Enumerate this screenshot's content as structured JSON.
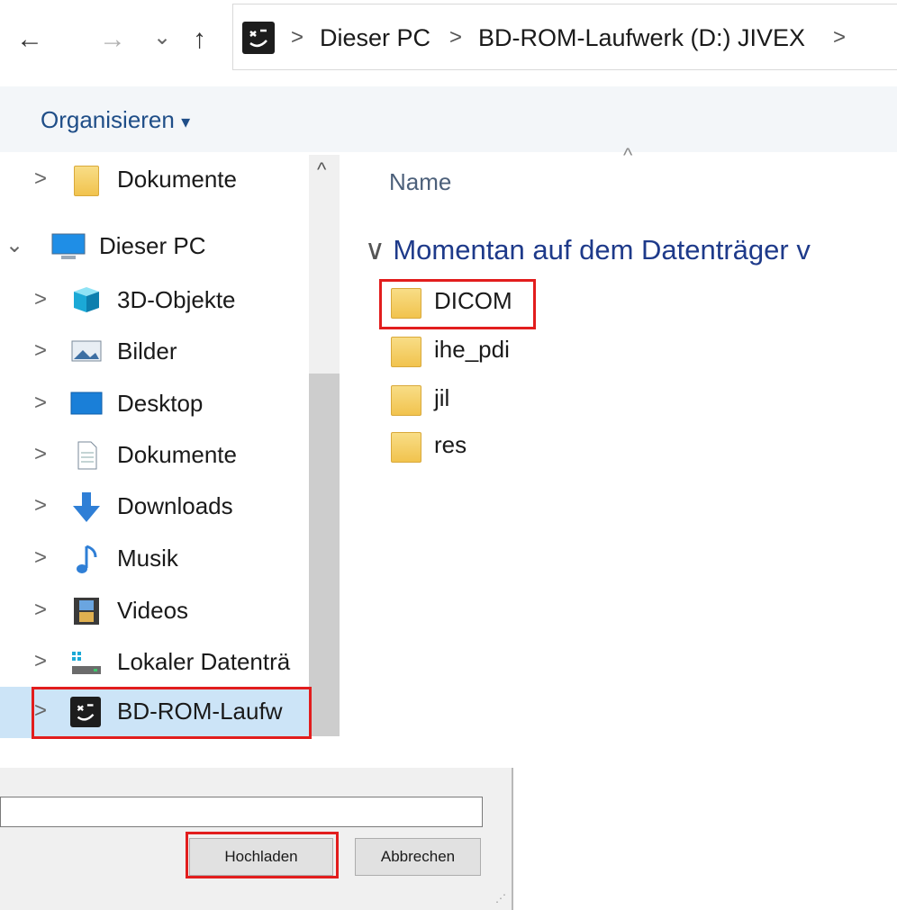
{
  "nav": {
    "back_glyph": "←",
    "forward_glyph": "→",
    "recent_glyph": "⌄",
    "up_glyph": "↑"
  },
  "breadcrumb": {
    "separator": ">",
    "items": [
      "Dieser PC",
      "BD-ROM-Laufwerk (D:) JIVEX"
    ]
  },
  "toolbar": {
    "organise_label": "Organisieren",
    "organise_caret": "▾"
  },
  "tree": {
    "items": [
      {
        "label": "Dokumente",
        "icon": "folder-icon",
        "chevron": ">"
      },
      {
        "label": "Dieser PC",
        "icon": "computer-icon",
        "chevron": "⌄"
      },
      {
        "label": "3D-Objekte",
        "icon": "cube-icon",
        "chevron": ">"
      },
      {
        "label": "Bilder",
        "icon": "pictures-icon",
        "chevron": ">"
      },
      {
        "label": "Desktop",
        "icon": "desktop-icon",
        "chevron": ">"
      },
      {
        "label": "Dokumente",
        "icon": "document-icon",
        "chevron": ">"
      },
      {
        "label": "Downloads",
        "icon": "download-arrow-icon",
        "chevron": ">"
      },
      {
        "label": "Musik",
        "icon": "music-note-icon",
        "chevron": ">"
      },
      {
        "label": "Videos",
        "icon": "film-icon",
        "chevron": ">"
      },
      {
        "label": "Lokaler Datenträ",
        "icon": "hard-drive-icon",
        "chevron": ">"
      },
      {
        "label": "BD-ROM-Laufw",
        "icon": "bd-drive-icon",
        "chevron": ">"
      }
    ]
  },
  "scrollbar": {
    "up_glyph": "^"
  },
  "content": {
    "column_header": "Name",
    "sort_glyph": "^",
    "group_glyph": "∨",
    "group_title": "Momentan auf dem Datenträger v",
    "files": [
      {
        "name": "DICOM",
        "icon": "folder-icon"
      },
      {
        "name": "ihe_pdi",
        "icon": "folder-icon"
      },
      {
        "name": "jil",
        "icon": "folder-icon"
      },
      {
        "name": "res",
        "icon": "folder-icon"
      }
    ]
  },
  "dialog": {
    "filename_value": "",
    "upload_button": "Hochladen",
    "cancel_button": "Abbrechen",
    "grip_glyph": "⋰"
  },
  "colors": {
    "highlight": "#e21d1d",
    "selection": "#cce4f7",
    "group_title": "#1e3a8a"
  }
}
